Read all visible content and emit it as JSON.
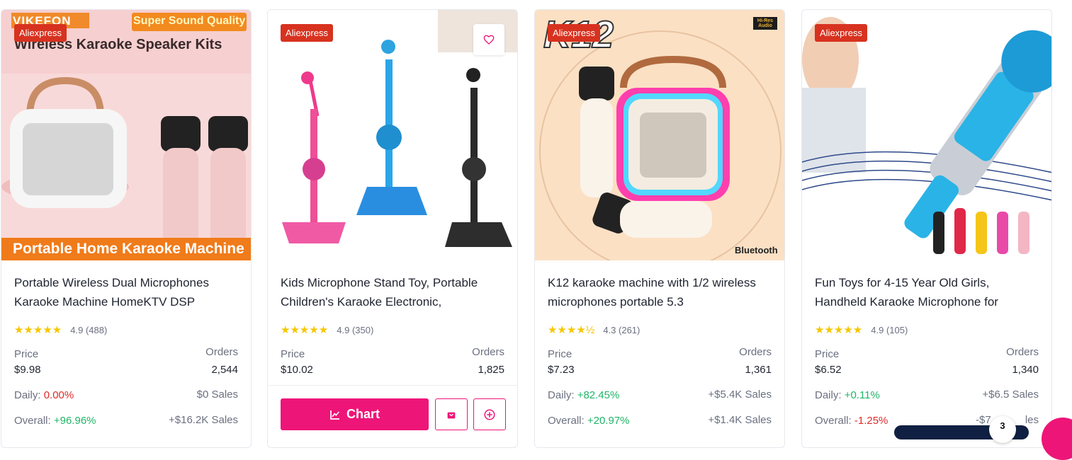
{
  "products": [
    {
      "badge": "Aliexpress",
      "image_text": {
        "brand": "VIKEFON",
        "top": "Super Sound Quality",
        "heading": "Wireless Karaoke Speaker Kits",
        "bottom": "Portable Home Karaoke Machine"
      },
      "title": "Portable Wireless Dual Microphones Karaoke Machine HomeKTV DSP",
      "rating": "4.9",
      "reviews": "(488)",
      "stars": "★★★★★",
      "price_label": "Price",
      "price": "$9.98",
      "orders_label": "Orders",
      "orders": "2,544",
      "daily_label": "Daily:",
      "daily": "0.00%",
      "daily_sales": "$0 Sales",
      "overall_label": "Overall:",
      "overall": "+96.96%",
      "overall_sales": "+$16.2K Sales"
    },
    {
      "badge": "Aliexpress",
      "title": "Kids Microphone Stand Toy, Portable Children's Karaoke Electronic,",
      "rating": "4.9",
      "reviews": "(350)",
      "stars": "★★★★★",
      "price_label": "Price",
      "price": "$10.02",
      "orders_label": "Orders",
      "orders": "1,825",
      "chart_label": "Chart"
    },
    {
      "badge": "Aliexpress",
      "image_text": {
        "model": "K12",
        "hires": "Hi-Res Audio",
        "bt": "Bluetooth"
      },
      "title": "K12 karaoke machine with 1/2 wireless microphones portable 5.3",
      "rating": "4.3",
      "reviews": "(261)",
      "stars": "★★★★½",
      "price_label": "Price",
      "price": "$7.23",
      "orders_label": "Orders",
      "orders": "1,361",
      "daily_label": "Daily:",
      "daily": "+82.45%",
      "daily_sales": "+$5.4K Sales",
      "overall_label": "Overall:",
      "overall": "+20.97%",
      "overall_sales": "+$1.4K Sales"
    },
    {
      "badge": "Aliexpress",
      "title": "Fun Toys for 4-15 Year Old Girls, Handheld Karaoke Microphone for",
      "rating": "4.9",
      "reviews": "(105)",
      "stars": "★★★★★",
      "price_label": "Price",
      "price": "$6.52",
      "orders_label": "Orders",
      "orders": "1,340",
      "daily_label": "Daily:",
      "daily": "+0.11%",
      "daily_sales": "+$6.5 Sales",
      "overall_label": "Overall:",
      "overall": "-1.25%",
      "overall_sales": "-$7",
      "overall_sales_tail": "les"
    }
  ],
  "floating": {
    "notification_count": "3"
  },
  "colors": {
    "accent": "#ee1578",
    "badge": "#d7321f",
    "positive": "#1fb567",
    "negative": "#e02b2b",
    "star": "#f7c600"
  }
}
